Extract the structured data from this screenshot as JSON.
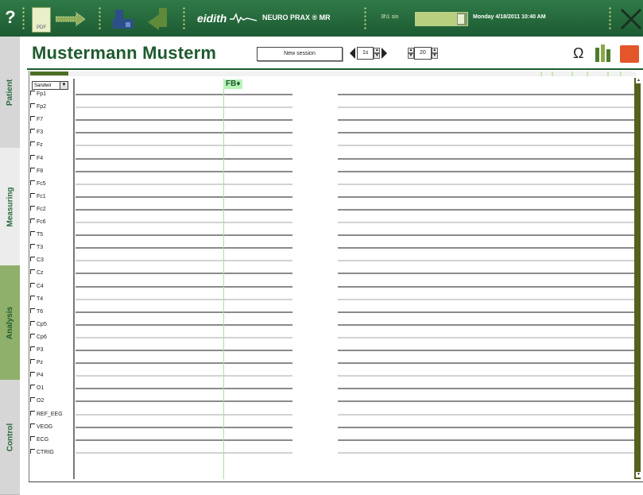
{
  "toolbar": {
    "help_label": "?",
    "pdf_label": "PDF",
    "logo_text": "eidith",
    "product": "NEURO PRAX ® MR",
    "timer": "3h1 sin",
    "timebar_fraction": 0.8,
    "datetime": "Monday 4/18/2011 10:40 AM"
  },
  "sidebar": {
    "tabs": [
      {
        "label": "Patient"
      },
      {
        "label": "Measuring"
      },
      {
        "label": "Analysis"
      },
      {
        "label": "Control"
      }
    ],
    "active": "Analysis"
  },
  "header": {
    "patient_name": "Mustermann  Musterm",
    "new_session_label": "New session",
    "timebase_value": "1s",
    "scale_value": "20"
  },
  "icons": {
    "omega": "Ω",
    "colors": {
      "brand": "#1f5a30",
      "stop": "#e2562a",
      "marker": "#9ee79e"
    }
  },
  "eeg": {
    "montage": "Sandwir",
    "marker_label": "FB♦",
    "channels": [
      "Fp1",
      "Fp2",
      "F7",
      "F3",
      "Fz",
      "F4",
      "F8",
      "Fc5",
      "Fc1",
      "Fc2",
      "Fc6",
      "T5",
      "T3",
      "C3",
      "Cz",
      "C4",
      "T4",
      "T6",
      "Cp5",
      "Cp6",
      "P3",
      "Pz",
      "P4",
      "O1",
      "O2",
      "REF_EEG",
      "VEOG",
      "ECG",
      "CTRIG"
    ]
  }
}
